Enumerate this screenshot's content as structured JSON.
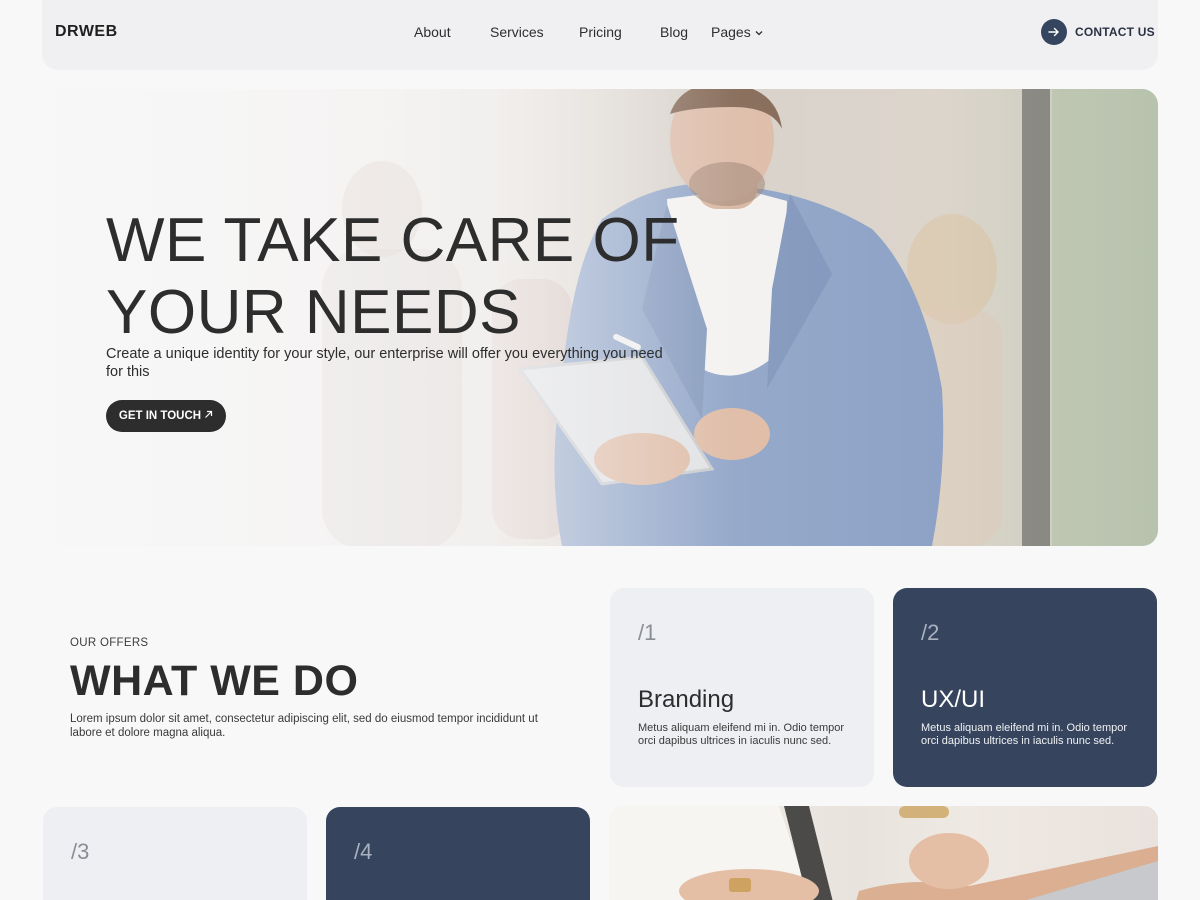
{
  "nav": {
    "logo": "DRWEB",
    "links": [
      "About",
      "Services",
      "Pricing",
      "Blog",
      "Pages"
    ],
    "pages_chevron": "⌄",
    "contact_icon": "arrow-right-icon",
    "contact_label": "CONTACT US"
  },
  "hero": {
    "title_line1": "WE TAKE CARE OF",
    "title_line2": "YOUR NEEDS",
    "subtitle": "Create a unique identity for your style, our enterprise will offer you everything you need for this",
    "cta_label": "GET IN TOUCH",
    "cta_icon": "arrow-up-right-icon"
  },
  "offers": {
    "eyebrow": "OUR OFFERS",
    "title": "WHAT WE DO",
    "description": "Lorem ipsum dolor sit amet, consectetur adipiscing elit, sed do eiusmod tempor incididunt ut labore et dolore magna aliqua.",
    "cards": [
      {
        "num": "/1",
        "title": "Branding",
        "desc": "Metus aliquam eleifend mi in. Odio tempor orci dapibus ultrices in iaculis nunc sed."
      },
      {
        "num": "/2",
        "title": "UX/UI",
        "desc": "Metus aliquam eleifend mi in. Odio tempor orci dapibus ultrices in iaculis nunc sed."
      },
      {
        "num": "/3"
      },
      {
        "num": "/4"
      }
    ]
  },
  "colors": {
    "accent_dark": "#36445d",
    "card_light": "#eeeff3",
    "page_bg": "#f8f8f9",
    "text": "#2d2d2d"
  }
}
